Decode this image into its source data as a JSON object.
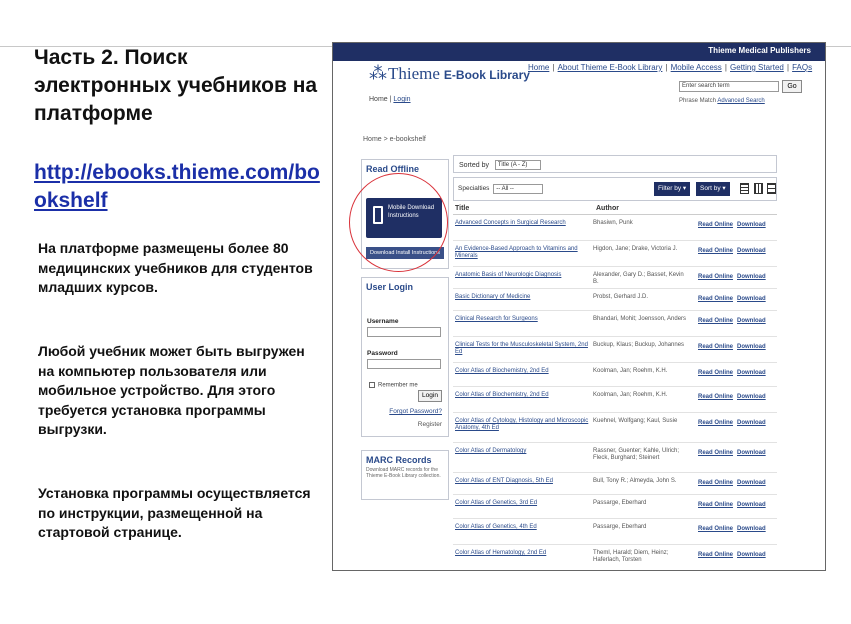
{
  "slide": {
    "title": "Часть 2. Поиск электронных учебников на платформе",
    "link": "http://ebooks.thieme.com/bookshelf",
    "paragraphs": [
      "На платформе размещены более 80 медицинских учебников для студентов младших курсов.",
      "Любой учебник может быть выгружен на компьютер пользователя или мобильное устройство.  Для этого требуется установка программы выгрузки.",
      "Установка программы осуществляется по инструкции, размещенной на стартовой странице."
    ]
  },
  "site": {
    "publisher": "Thieme Medical Publishers",
    "logo_name": "Thieme",
    "logo_product": "E-Book Library",
    "home_prefix": "Home",
    "home_link": "Login",
    "nav": [
      "Home",
      "About Thieme E-Book Library",
      "Mobile Access",
      "Getting Started",
      "FAQs"
    ],
    "search_value": "Enter search term",
    "go_label": "Go",
    "adv_prefix": "Phrase Match",
    "adv_link": "Advanced Search",
    "breadcrumb": "Home > e-bookshelf",
    "read_offline_title": "Read Offline",
    "mobile_download": "Mobile Download Instructions",
    "install_button": "Download Install Instructions",
    "login_title": "User Login",
    "username_label": "Username",
    "password_label": "Password",
    "remember_label": "Remember me",
    "login_button": "Login",
    "forgot_link": "Forgot Password?",
    "register_link": "Register",
    "marc_title": "MARC Records",
    "marc_text": "Download MARC records for the Thieme E-Book Library collection.",
    "sorted_label": "Sorted by",
    "sorted_value": "Title (A - Z)",
    "specialties_label": "Specialties",
    "specialties_value": "-- All --",
    "filter_label": "Filter by ▾",
    "sortby_label": "Sort by ▾",
    "col_title": "Title",
    "col_author": "Author",
    "read_online": "Read Online",
    "download": "Download",
    "books": [
      {
        "title": "Advanced Concepts in Surgical Research",
        "author": "Bhasiwn, Punk"
      },
      {
        "title": "An Evidence-Based Approach to Vitamins and Minerals",
        "author": "Higdon, Jane; Drake, Victoria J."
      },
      {
        "title": "Anatomic Basis of Neurologic Diagnosis",
        "author": "Alexander, Gary D.; Basset, Kevin B."
      },
      {
        "title": "Basic Dictionary of Medicine",
        "author": "Probst, Gerhard J.D."
      },
      {
        "title": "Clinical Research for Surgeons",
        "author": "Bhandari, Mohit; Joensson, Anders"
      },
      {
        "title": "Clinical Tests for the Musculoskeletal System, 2nd Ed",
        "author": "Buckup, Klaus; Buckup, Johannes"
      },
      {
        "title": "Color Atlas of Biochemistry, 2nd Ed",
        "author": "Koolman, Jan; Roehm, K.H."
      },
      {
        "title": "Color Atlas of Biochemistry, 2nd Ed",
        "author": "Koolman, Jan; Roehm, K.H."
      },
      {
        "title": "Color Atlas of Cytology, Histology and Microscopic Anatomy, 4th Ed",
        "author": "Kuehnel, Wolfgang; Kaul, Susie"
      },
      {
        "title": "Color Atlas of Dermatology",
        "author": "Rassner, Guenter; Kahle, Ulrich; Fleck, Burghard; Steinert"
      },
      {
        "title": "Color Atlas of ENT Diagnosis, 5th Ed",
        "author": "Bull, Tony R.; Almeyda, John S."
      },
      {
        "title": "Color Atlas of Genetics, 3rd Ed",
        "author": "Passarge, Eberhard"
      },
      {
        "title": "Color Atlas of Genetics, 4th Ed",
        "author": "Passarge, Eberhard"
      },
      {
        "title": "Color Atlas of Hematology, 2nd Ed",
        "author": "Theml, Harald; Diem, Heinz; Haferlach, Torsten"
      }
    ]
  }
}
